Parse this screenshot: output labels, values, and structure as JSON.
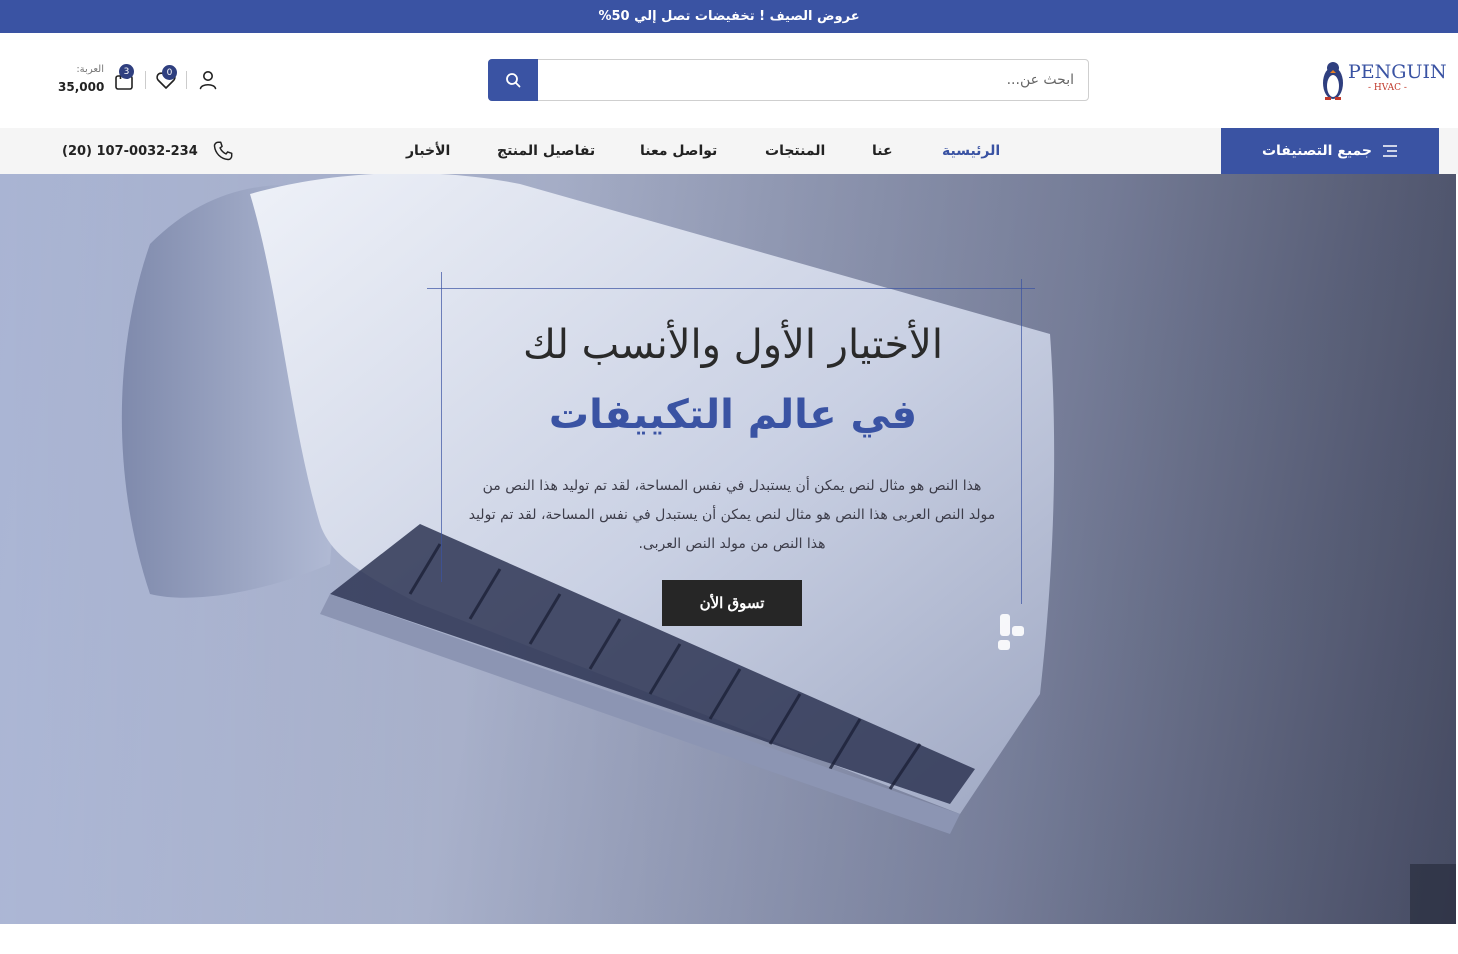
{
  "promo": {
    "text": "عروض الصيف ! تخفيضات تصل إلي 50%"
  },
  "header": {
    "logo_text": "PENGUIN",
    "logo_sub": "- HVAC -",
    "search_placeholder": "ابحث عن...",
    "wishlist_count": "0",
    "cart_count": "3",
    "cart_label": "العربة:",
    "cart_total": "35,000"
  },
  "nav": {
    "categories_label": "جميع التصنيفات",
    "items": [
      {
        "label": "الرئيسية",
        "active": true
      },
      {
        "label": "عنا"
      },
      {
        "label": "المنتجات"
      },
      {
        "label": "تواصل معنا"
      },
      {
        "label": "تفاصيل المنتج"
      },
      {
        "label": "الأخبار"
      }
    ],
    "phone": "(20) 107-0032-234"
  },
  "hero": {
    "title_line1": "الأختيار الأول والأنسب لك",
    "title_line2": "في عالم التكييفات",
    "description": "هذا النص هو مثال لنص يمكن أن يستبدل في نفس المساحة، لقد تم توليد هذا النص من مولد النص العربى هذا النص هو مثال لنص يمكن أن يستبدل في نفس المساحة، لقد تم توليد هذا النص من مولد النص العربى.",
    "button_label": "تسوق الأن"
  },
  "colors": {
    "brand": "#3a53a3",
    "dark_button": "#262626",
    "nav_bg": "#f5f5f5"
  },
  "icons": [
    "search-icon",
    "user-icon",
    "heart-icon",
    "cart-icon",
    "menu-icon",
    "phone-icon",
    "penguin-logo"
  ]
}
